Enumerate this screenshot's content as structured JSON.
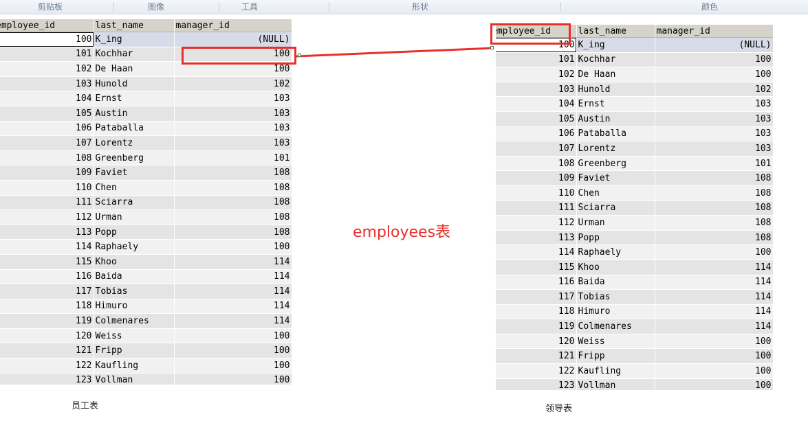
{
  "ribbon": {
    "groups": [
      "剪贴板",
      "图像",
      "工具",
      "形状",
      "颜色"
    ]
  },
  "left_table": {
    "columns": [
      "employee_id",
      "last_name",
      "manager_id"
    ],
    "rows": [
      [
        "100",
        "K_ing",
        "(NULL)"
      ],
      [
        "101",
        "Kochhar",
        "100"
      ],
      [
        "102",
        "De Haan",
        "100"
      ],
      [
        "103",
        "Hunold",
        "102"
      ],
      [
        "104",
        "Ernst",
        "103"
      ],
      [
        "105",
        "Austin",
        "103"
      ],
      [
        "106",
        "Pataballa",
        "103"
      ],
      [
        "107",
        "Lorentz",
        "103"
      ],
      [
        "108",
        "Greenberg",
        "101"
      ],
      [
        "109",
        "Faviet",
        "108"
      ],
      [
        "110",
        "Chen",
        "108"
      ],
      [
        "111",
        "Sciarra",
        "108"
      ],
      [
        "112",
        "Urman",
        "108"
      ],
      [
        "113",
        "Popp",
        "108"
      ],
      [
        "114",
        "Raphaely",
        "100"
      ],
      [
        "115",
        "Khoo",
        "114"
      ],
      [
        "116",
        "Baida",
        "114"
      ],
      [
        "117",
        "Tobias",
        "114"
      ],
      [
        "118",
        "Himuro",
        "114"
      ],
      [
        "119",
        "Colmenares",
        "114"
      ],
      [
        "120",
        "Weiss",
        "100"
      ],
      [
        "121",
        "Fripp",
        "100"
      ],
      [
        "122",
        "Kaufling",
        "100"
      ],
      [
        "123",
        "Vollman",
        "100"
      ]
    ],
    "caption": "员工表"
  },
  "right_table": {
    "columns": [
      "employee_id",
      "last_name",
      "manager_id"
    ],
    "rows": [
      [
        "100",
        "K_ing",
        "(NULL)"
      ],
      [
        "101",
        "Kochhar",
        "100"
      ],
      [
        "102",
        "De Haan",
        "100"
      ],
      [
        "103",
        "Hunold",
        "102"
      ],
      [
        "104",
        "Ernst",
        "103"
      ],
      [
        "105",
        "Austin",
        "103"
      ],
      [
        "106",
        "Pataballa",
        "103"
      ],
      [
        "107",
        "Lorentz",
        "103"
      ],
      [
        "108",
        "Greenberg",
        "101"
      ],
      [
        "109",
        "Faviet",
        "108"
      ],
      [
        "110",
        "Chen",
        "108"
      ],
      [
        "111",
        "Sciarra",
        "108"
      ],
      [
        "112",
        "Urman",
        "108"
      ],
      [
        "113",
        "Popp",
        "108"
      ],
      [
        "114",
        "Raphaely",
        "100"
      ],
      [
        "115",
        "Khoo",
        "114"
      ],
      [
        "116",
        "Baida",
        "114"
      ],
      [
        "117",
        "Tobias",
        "114"
      ],
      [
        "118",
        "Himuro",
        "114"
      ],
      [
        "119",
        "Colmenares",
        "114"
      ],
      [
        "120",
        "Weiss",
        "100"
      ],
      [
        "121",
        "Fripp",
        "100"
      ],
      [
        "122",
        "Kaufling",
        "100"
      ],
      [
        "123",
        "Vollman",
        "100"
      ]
    ],
    "caption": "领导表"
  },
  "center_label": "employees表",
  "colors": {
    "highlight": "#e8302a",
    "header_bg": "#d6d3ca"
  }
}
